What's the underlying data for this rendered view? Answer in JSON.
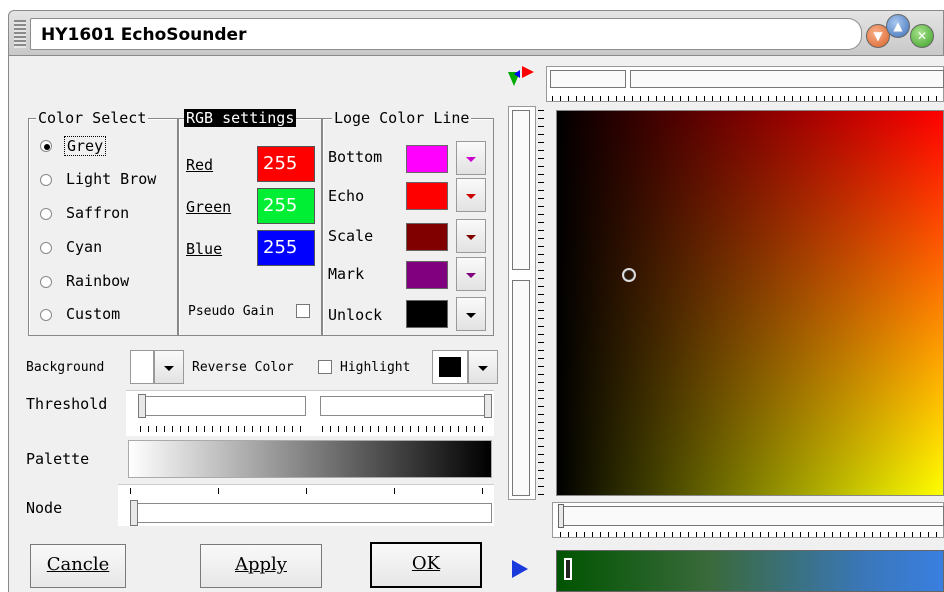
{
  "window": {
    "title": "HY1601 EchoSounder",
    "buttons": {
      "minimize_icon": "orange-down-arrow-icon",
      "maximize_icon": "blue-up-arrow-icon",
      "close_icon": "green-close-icon"
    }
  },
  "color_select": {
    "title": "Color Select",
    "options": [
      "Grey",
      "Light Brow",
      "Saffron",
      "Cyan",
      "Rainbow",
      "Custom"
    ],
    "selected": "Grey"
  },
  "rgb_settings": {
    "title": "RGB settings",
    "red_label": "Red",
    "green_label": "Green",
    "blue_label": "Blue",
    "red_value": "255",
    "green_value": "255",
    "blue_value": "255",
    "pseudo_gain_label": "Pseudo Gain"
  },
  "loge_color_line": {
    "title": "Loge Color Line",
    "items": [
      {
        "label": "Bottom",
        "color": "#ff00ff"
      },
      {
        "label": "Echo",
        "color": "#ff0000"
      },
      {
        "label": "Scale",
        "color": "#800000"
      },
      {
        "label": "Mark",
        "color": "#800080"
      },
      {
        "label": "Unlock",
        "color": "#000000"
      }
    ]
  },
  "options_row": {
    "background_label": "Background",
    "reverse_color_label": "Reverse Color",
    "highlight_label": "Highlight",
    "highlight_color": "#000000"
  },
  "threshold_label": "Threshold",
  "palette_label": "Palette",
  "node_label": "Node",
  "buttons": {
    "cancel": "Cancle",
    "apply": "Apply",
    "ok": "OK"
  }
}
